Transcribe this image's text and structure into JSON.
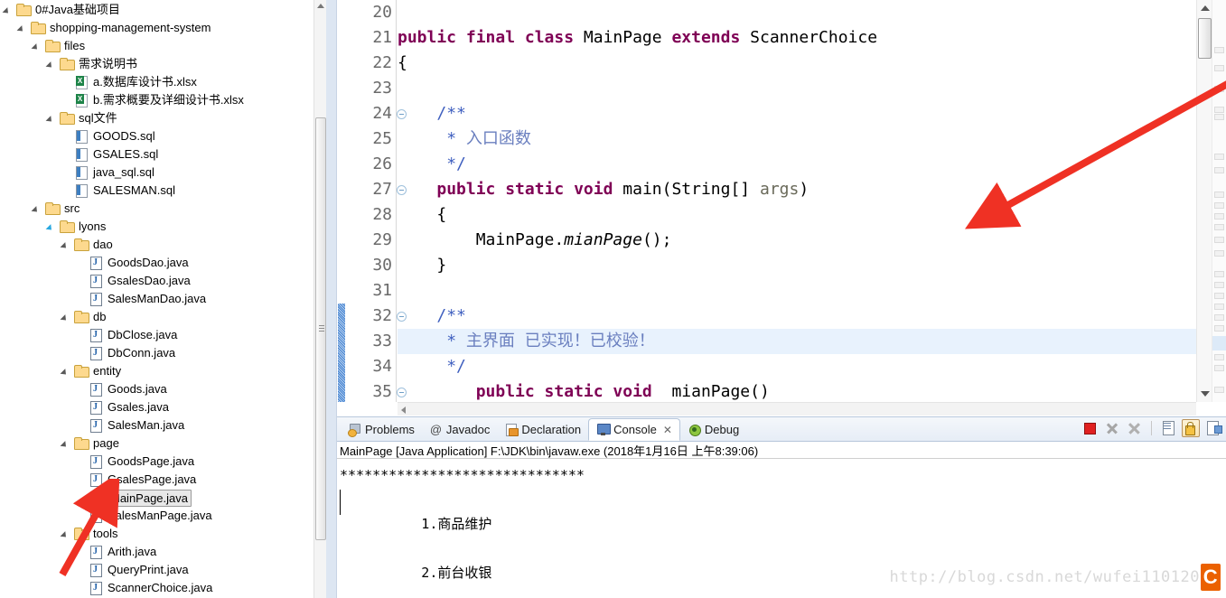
{
  "sidebar": {
    "name": "package-explorer",
    "tree": [
      {
        "depth": 0,
        "type": "folder",
        "twisty": "open",
        "label": "0#Java基础项目"
      },
      {
        "depth": 1,
        "type": "folder",
        "twisty": "open",
        "label": "shopping-management-system"
      },
      {
        "depth": 2,
        "type": "folder",
        "twisty": "open",
        "label": "files"
      },
      {
        "depth": 3,
        "type": "folder",
        "twisty": "open",
        "label": "需求说明书"
      },
      {
        "depth": 4,
        "type": "xls",
        "twisty": "none",
        "label": "a.数据库设计书.xlsx"
      },
      {
        "depth": 4,
        "type": "xls",
        "twisty": "none",
        "label": "b.需求概要及详细设计书.xlsx"
      },
      {
        "depth": 3,
        "type": "folder",
        "twisty": "open",
        "label": "sql文件"
      },
      {
        "depth": 4,
        "type": "sql",
        "twisty": "none",
        "label": "GOODS.sql"
      },
      {
        "depth": 4,
        "type": "sql",
        "twisty": "none",
        "label": "GSALES.sql"
      },
      {
        "depth": 4,
        "type": "sql",
        "twisty": "none",
        "label": "java_sql.sql"
      },
      {
        "depth": 4,
        "type": "sql",
        "twisty": "none",
        "label": "SALESMAN.sql"
      },
      {
        "depth": 2,
        "type": "folder",
        "twisty": "open",
        "label": "src"
      },
      {
        "depth": 3,
        "type": "folder",
        "twisty": "open-blue",
        "label": "lyons"
      },
      {
        "depth": 4,
        "type": "folder",
        "twisty": "open",
        "label": "dao"
      },
      {
        "depth": 5,
        "type": "java",
        "twisty": "none",
        "label": "GoodsDao.java"
      },
      {
        "depth": 5,
        "type": "java",
        "twisty": "none",
        "label": "GsalesDao.java"
      },
      {
        "depth": 5,
        "type": "java",
        "twisty": "none",
        "label": "SalesManDao.java"
      },
      {
        "depth": 4,
        "type": "folder",
        "twisty": "open",
        "label": "db"
      },
      {
        "depth": 5,
        "type": "java",
        "twisty": "none",
        "label": "DbClose.java"
      },
      {
        "depth": 5,
        "type": "java",
        "twisty": "none",
        "label": "DbConn.java"
      },
      {
        "depth": 4,
        "type": "folder",
        "twisty": "open",
        "label": "entity"
      },
      {
        "depth": 5,
        "type": "java",
        "twisty": "none",
        "label": "Goods.java"
      },
      {
        "depth": 5,
        "type": "java",
        "twisty": "none",
        "label": "Gsales.java"
      },
      {
        "depth": 5,
        "type": "java",
        "twisty": "none",
        "label": "SalesMan.java"
      },
      {
        "depth": 4,
        "type": "folder",
        "twisty": "open",
        "label": "page"
      },
      {
        "depth": 5,
        "type": "java",
        "twisty": "none",
        "label": "GoodsPage.java"
      },
      {
        "depth": 5,
        "type": "java",
        "twisty": "none",
        "label": "GsalesPage.java"
      },
      {
        "depth": 5,
        "type": "java",
        "twisty": "none",
        "label": "MainPage.java",
        "selected": true
      },
      {
        "depth": 5,
        "type": "java",
        "twisty": "none",
        "label": "SalesManPage.java"
      },
      {
        "depth": 4,
        "type": "folder",
        "twisty": "open",
        "label": "tools"
      },
      {
        "depth": 5,
        "type": "java",
        "twisty": "none",
        "label": "Arith.java"
      },
      {
        "depth": 5,
        "type": "java",
        "twisty": "none",
        "label": "QueryPrint.java"
      },
      {
        "depth": 5,
        "type": "java",
        "twisty": "none",
        "label": "ScannerChoice.java"
      }
    ]
  },
  "editor": {
    "first_line": 20,
    "lines": [
      {
        "n": "20",
        "fold": false,
        "html": ""
      },
      {
        "n": "21",
        "fold": false,
        "html": "<span class='kw'>public final class </span><span class='cls'>MainPage </span><span class='kw'>extends </span><span class='cls'>ScannerChoice</span>"
      },
      {
        "n": "22",
        "fold": false,
        "html": "<span class='cls'>{</span>"
      },
      {
        "n": "23",
        "fold": false,
        "html": ""
      },
      {
        "n": "24",
        "fold": true,
        "html": "    <span class='jdoc'>/**</span>"
      },
      {
        "n": "25",
        "fold": false,
        "html": "     <span class='jdoc'>* </span><span class='jdoc-cn'>入口函数</span>"
      },
      {
        "n": "26",
        "fold": false,
        "html": "     <span class='jdoc'>*/</span>"
      },
      {
        "n": "27",
        "fold": true,
        "html": "    <span class='kw'>public static void </span><span class='cls'>main(String[] </span><span class='param'>args</span><span class='cls'>)</span>"
      },
      {
        "n": "28",
        "fold": false,
        "html": "    <span class='cls'>{</span>"
      },
      {
        "n": "29",
        "fold": false,
        "html": "        <span class='cls'>MainPage.</span><span class='mth'>mianPage</span><span class='cls'>();</span>"
      },
      {
        "n": "30",
        "fold": false,
        "html": "    <span class='cls'>}</span>"
      },
      {
        "n": "31",
        "fold": false,
        "html": ""
      },
      {
        "n": "32",
        "fold": true,
        "html": "    <span class='jdoc'>/**</span>"
      },
      {
        "n": "33",
        "fold": false,
        "highlight": true,
        "html": "     <span class='jdoc'>* </span><span class='jdoc-cn'>主界面 已实现！已校验！</span>"
      },
      {
        "n": "34",
        "fold": false,
        "html": "     <span class='jdoc'>*/</span>"
      },
      {
        "n": "35",
        "fold": true,
        "html": "        <span class='kw'>public static void  </span><span class='cls'>mianPage()</span>"
      }
    ]
  },
  "console": {
    "tabs": [
      {
        "icon": "problems",
        "label": "Problems",
        "active": false,
        "closable": false
      },
      {
        "icon": "at",
        "label": "Javadoc",
        "active": false,
        "closable": false
      },
      {
        "icon": "decl",
        "label": "Declaration",
        "active": false,
        "closable": false
      },
      {
        "icon": "console",
        "label": "Console",
        "active": true,
        "closable": true,
        "close": "✕"
      },
      {
        "icon": "debug",
        "label": "Debug",
        "active": false,
        "closable": false
      }
    ],
    "toolbar": [
      {
        "name": "terminate-button",
        "icon": "i-stop",
        "pressed": false
      },
      {
        "name": "remove-launch-button",
        "icon": "i-x",
        "pressed": false
      },
      {
        "name": "remove-all-terminated-button",
        "icon": "i-xx",
        "pressed": false
      },
      {
        "name": "separator",
        "icon": "sep",
        "pressed": false
      },
      {
        "name": "clear-console-button",
        "icon": "i-doc",
        "pressed": false
      },
      {
        "name": "scroll-lock-button",
        "icon": "i-lock",
        "pressed": true
      },
      {
        "name": "pin-console-button",
        "icon": "i-pin",
        "pressed": false
      }
    ],
    "launch_line": "MainPage [Java Application] F:\\JDK\\bin\\javaw.exe (2018年1月16日 上午8:39:06)",
    "output": [
      "******************************",
      "",
      "          1.商品维护",
      "",
      "          2.前台收银"
    ]
  },
  "watermark": {
    "url": "http://blog.csdn.net/wufei110120",
    "logo": "C"
  },
  "annotations": {
    "arrow_editor": "red-arrow-pointing-to-main-method",
    "arrow_sidebar": "red-arrow-pointing-to-mainpage-java",
    "arrow_color": "#ef3124"
  }
}
